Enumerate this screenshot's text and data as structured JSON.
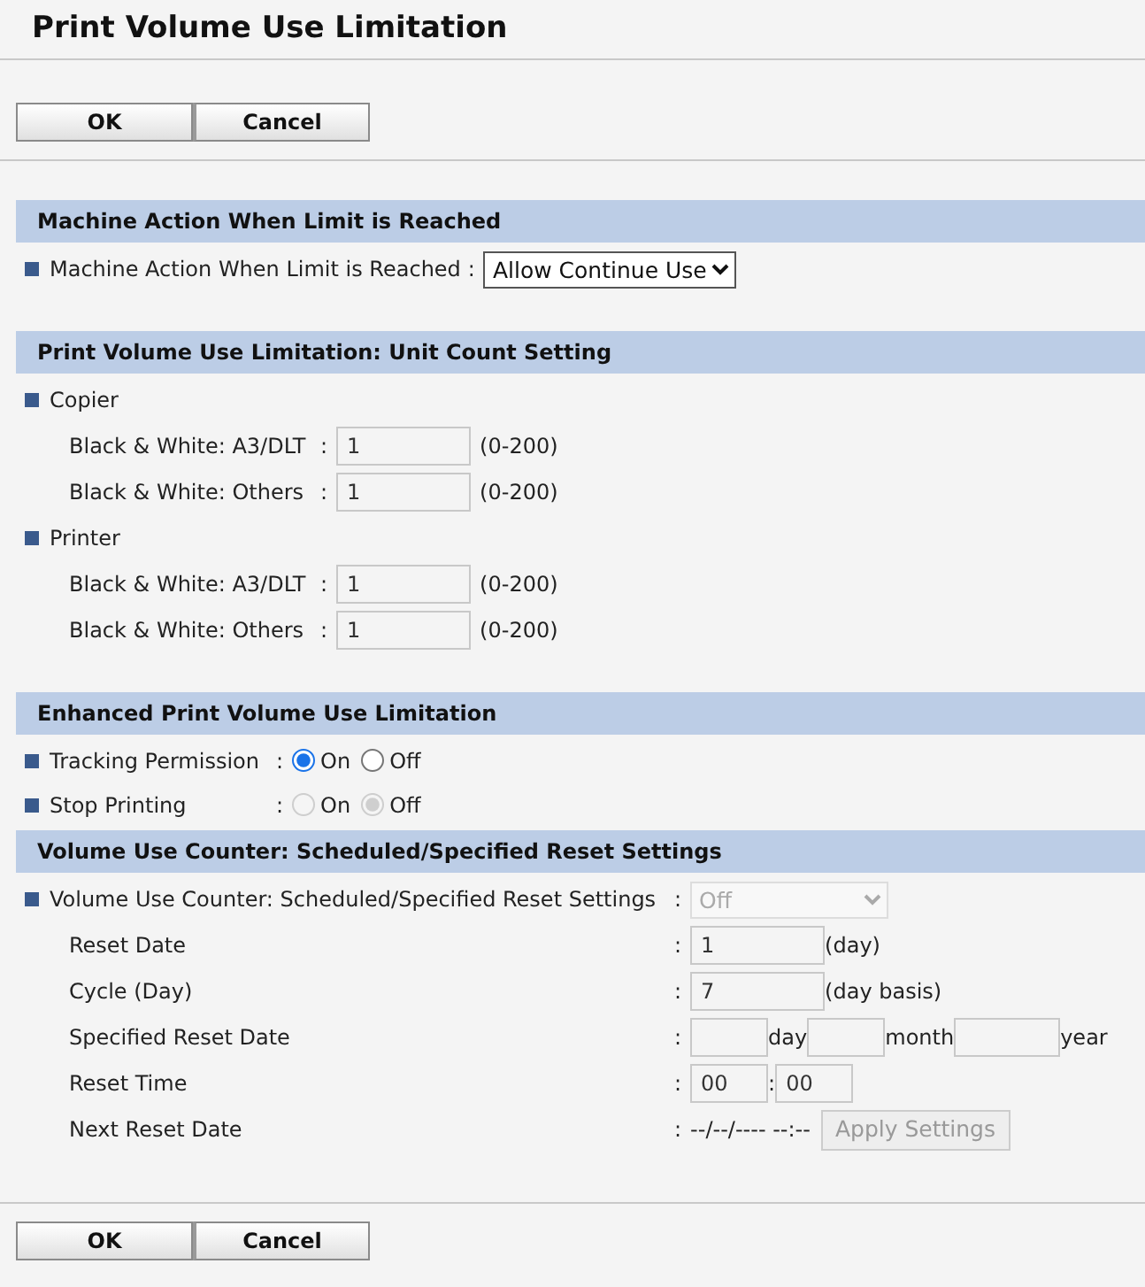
{
  "title": "Print Volume Use Limitation",
  "top_buttons": [
    "OK",
    "Cancel"
  ],
  "sections": [
    {
      "kind": "single",
      "heading": "Machine Action When Limit is Reached",
      "rows": [
        {
          "kind": "select",
          "label": "Machine Action When Limit is Reached",
          "colon": ":",
          "value": "Allow Continue Use",
          "disabled": false
        }
      ]
    },
    {
      "kind": "counts",
      "heading": "Print Volume Use Limitation: Unit Count Setting",
      "rows": [
        {
          "kind": "group",
          "label": "Copier"
        },
        {
          "kind": "count",
          "label": "Black & White: A3/DLT",
          "colon": ":",
          "value": "1",
          "range": "(0-200)"
        },
        {
          "kind": "count",
          "label": "Black & White: Others",
          "colon": ":",
          "value": "1",
          "range": "(0-200)"
        },
        {
          "kind": "group",
          "label": "Printer"
        },
        {
          "kind": "count",
          "label": "Black & White: A3/DLT",
          "colon": ":",
          "value": "1",
          "range": "(0-200)"
        },
        {
          "kind": "count",
          "label": "Black & White: Others",
          "colon": ":",
          "value": "1",
          "range": "(0-200)"
        }
      ]
    },
    {
      "kind": "radios",
      "heading": "Enhanced Print Volume Use Limitation",
      "rows": [
        {
          "kind": "radio",
          "label": "Tracking Permission",
          "colon": ":",
          "disabled": false,
          "options": [
            {
              "label": "On",
              "selected": true
            },
            {
              "label": "Off",
              "selected": false
            }
          ]
        },
        {
          "kind": "radio",
          "label": "Stop Printing",
          "colon": ":",
          "disabled": true,
          "options": [
            {
              "label": "On",
              "selected": false
            },
            {
              "label": "Off",
              "selected": true
            }
          ]
        }
      ]
    },
    {
      "kind": "schedule",
      "heading": "Volume Use Counter: Scheduled/Specified Reset Settings",
      "rows": [
        {
          "kind": "select",
          "label": "Volume Use Counter: Scheduled/Specified Reset Settings",
          "colon": ":",
          "value": "Off",
          "disabled": true
        },
        {
          "kind": "parts",
          "label": "Reset Date",
          "colon": ":",
          "parts": [
            {
              "kind": "input",
              "value": "1"
            },
            {
              "kind": "text",
              "text": "(day)"
            }
          ]
        },
        {
          "kind": "parts",
          "label": "Cycle (Day)",
          "colon": ":",
          "parts": [
            {
              "kind": "input",
              "value": "7"
            },
            {
              "kind": "text",
              "text": "(day basis)"
            }
          ]
        },
        {
          "kind": "parts",
          "label": "Specified Reset Date",
          "colon": ":",
          "parts": [
            {
              "kind": "input"
            },
            {
              "kind": "text",
              "text": "day"
            },
            {
              "kind": "input"
            },
            {
              "kind": "text",
              "text": "month"
            },
            {
              "kind": "input"
            },
            {
              "kind": "text",
              "text": "year"
            }
          ]
        },
        {
          "kind": "parts",
          "label": "Reset Time",
          "colon": ":",
          "parts": [
            {
              "kind": "input",
              "value": "00"
            },
            {
              "kind": "text",
              "text": ":"
            },
            {
              "kind": "input",
              "value": "00"
            }
          ]
        },
        {
          "kind": "parts",
          "label": "Next Reset Date",
          "colon": ":",
          "parts": [
            {
              "kind": "text",
              "text": "--/--/---- --:--"
            },
            {
              "kind": "button",
              "text": "Apply Settings",
              "disabled": true
            }
          ]
        }
      ]
    }
  ],
  "bottom_buttons": [
    "OK",
    "Cancel"
  ]
}
